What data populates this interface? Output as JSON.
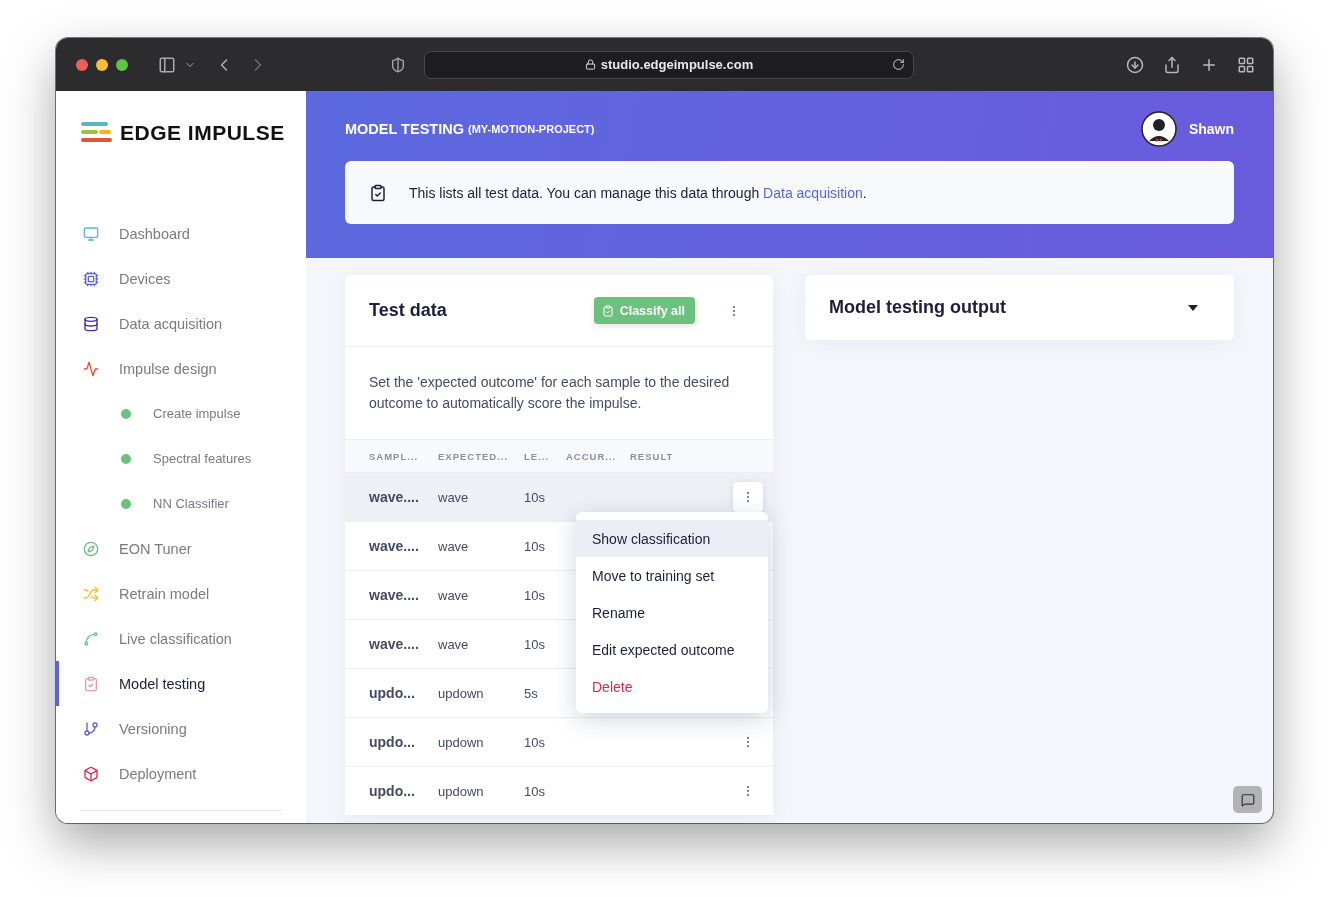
{
  "browser": {
    "url": "studio.edgeimpulse.com"
  },
  "sidebar": {
    "logo": "EDGE IMPULSE",
    "items": [
      {
        "label": "Dashboard",
        "selected": false
      },
      {
        "label": "Devices",
        "selected": false
      },
      {
        "label": "Data acquisition",
        "selected": false
      },
      {
        "label": "Impulse design",
        "selected": false,
        "children": [
          {
            "label": "Create impulse",
            "selected": false
          },
          {
            "label": "Spectral features",
            "selected": false
          },
          {
            "label": "NN Classifier",
            "selected": false
          }
        ]
      },
      {
        "label": "EON Tuner",
        "selected": false
      },
      {
        "label": "Retrain model",
        "selected": false
      },
      {
        "label": "Live classification",
        "selected": false
      },
      {
        "label": "Model testing",
        "selected": true
      },
      {
        "label": "Versioning",
        "selected": false
      },
      {
        "label": "Deployment",
        "selected": false
      }
    ]
  },
  "header": {
    "title": "MODEL TESTING",
    "project": "(MY-MOTION-PROJECT)",
    "user": "Shawn"
  },
  "notice": {
    "text": "This lists all test data. You can manage this data through ",
    "link": "Data acquisition",
    "end": "."
  },
  "test_data": {
    "title": "Test data",
    "classify_button": "Classify all",
    "description": "Set the 'expected outcome' for each sample to the desired outcome to automatically score the impulse.",
    "columns": [
      "SAMPL...",
      "EXPECTED...",
      "LE...",
      "ACCUR...",
      "RESULT"
    ],
    "rows": [
      {
        "sample": "wave....",
        "expected": "wave",
        "length": "10s",
        "active": true,
        "menu_button": true
      },
      {
        "sample": "wave....",
        "expected": "wave",
        "length": "10s",
        "active": false,
        "menu_button": false
      },
      {
        "sample": "wave....",
        "expected": "wave",
        "length": "10s",
        "active": false,
        "menu_button": false
      },
      {
        "sample": "wave....",
        "expected": "wave",
        "length": "10s",
        "active": false,
        "menu_button": false
      },
      {
        "sample": "updo...",
        "expected": "updown",
        "length": "5s",
        "active": false,
        "menu_button": false
      },
      {
        "sample": "updo...",
        "expected": "updown",
        "length": "10s",
        "active": false,
        "menu_button": true
      },
      {
        "sample": "updo...",
        "expected": "updown",
        "length": "10s",
        "active": false,
        "menu_button": true
      }
    ]
  },
  "context_menu": {
    "items": [
      {
        "label": "Show classification",
        "kind": "normal",
        "selected": true
      },
      {
        "label": "Move to training set",
        "kind": "normal",
        "selected": false
      },
      {
        "label": "Rename",
        "kind": "normal",
        "selected": false
      },
      {
        "label": "Edit expected outcome",
        "kind": "normal",
        "selected": false
      },
      {
        "label": "Delete",
        "kind": "danger",
        "selected": false
      }
    ]
  },
  "output": {
    "title": "Model testing output"
  }
}
